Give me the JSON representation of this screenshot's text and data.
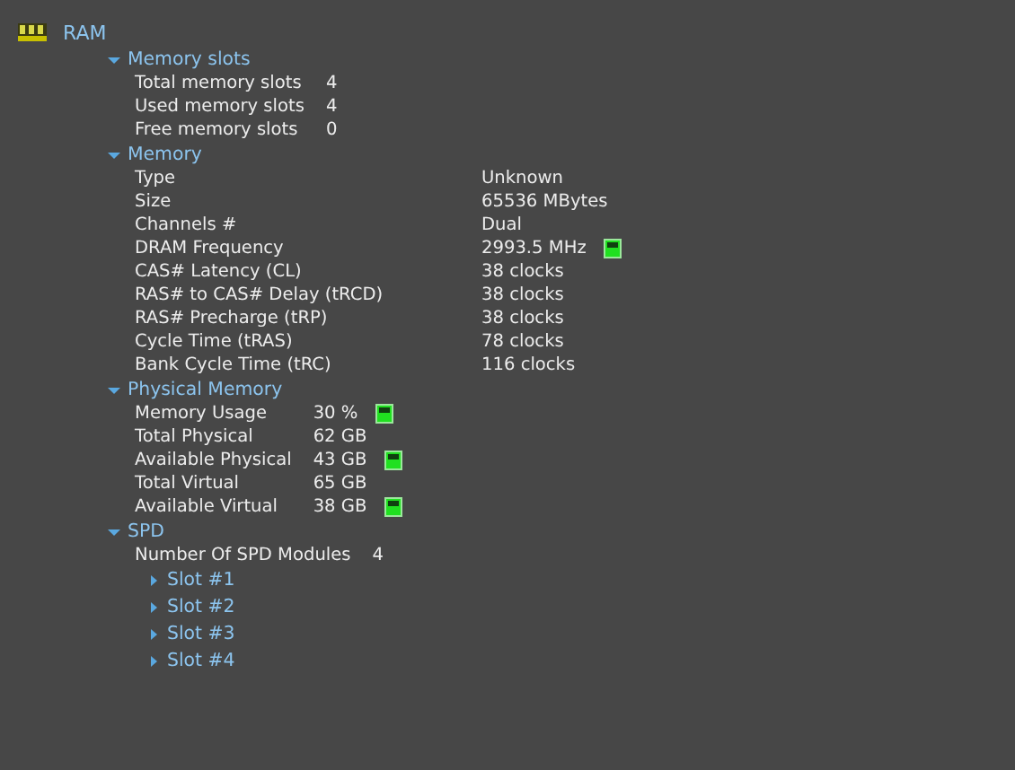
{
  "root": {
    "label": "RAM"
  },
  "sections": [
    {
      "title": "Memory slots",
      "expanded": true,
      "rows": [
        {
          "label": "Total memory slots",
          "value": "4",
          "meter": false
        },
        {
          "label": "Used memory slots",
          "value": "4",
          "meter": false
        },
        {
          "label": "Free memory slots",
          "value": "0",
          "meter": false
        }
      ]
    },
    {
      "title": "Memory",
      "expanded": true,
      "rows": [
        {
          "label": "Type",
          "value": "Unknown",
          "meter": false
        },
        {
          "label": "Size",
          "value": "65536 MBytes",
          "meter": false
        },
        {
          "label": "Channels #",
          "value": "Dual",
          "meter": false
        },
        {
          "label": "DRAM Frequency",
          "value": "2993.5 MHz",
          "meter": true
        },
        {
          "label": "CAS# Latency (CL)",
          "value": "38 clocks",
          "meter": false
        },
        {
          "label": "RAS# to CAS# Delay (tRCD)",
          "value": "38 clocks",
          "meter": false
        },
        {
          "label": "RAS# Precharge (tRP)",
          "value": "38 clocks",
          "meter": false
        },
        {
          "label": "Cycle Time (tRAS)",
          "value": "78 clocks",
          "meter": false
        },
        {
          "label": "Bank Cycle Time (tRC)",
          "value": "116 clocks",
          "meter": false
        }
      ]
    },
    {
      "title": "Physical Memory",
      "expanded": true,
      "rows": [
        {
          "label": "Memory Usage",
          "value": "30 %",
          "meter": true
        },
        {
          "label": "Total Physical",
          "value": "62 GB",
          "meter": false
        },
        {
          "label": "Available Physical",
          "value": "43 GB",
          "meter": true
        },
        {
          "label": "Total Virtual",
          "value": "65 GB",
          "meter": false
        },
        {
          "label": "Available Virtual",
          "value": "38 GB",
          "meter": true
        }
      ]
    },
    {
      "title": "SPD",
      "expanded": true,
      "rows": [
        {
          "label": "Number Of SPD Modules",
          "value": "4",
          "meter": false
        }
      ],
      "children": [
        {
          "title": "Slot #1",
          "expanded": false
        },
        {
          "title": "Slot #2",
          "expanded": false
        },
        {
          "title": "Slot #3",
          "expanded": false
        },
        {
          "title": "Slot #4",
          "expanded": false
        }
      ]
    }
  ]
}
